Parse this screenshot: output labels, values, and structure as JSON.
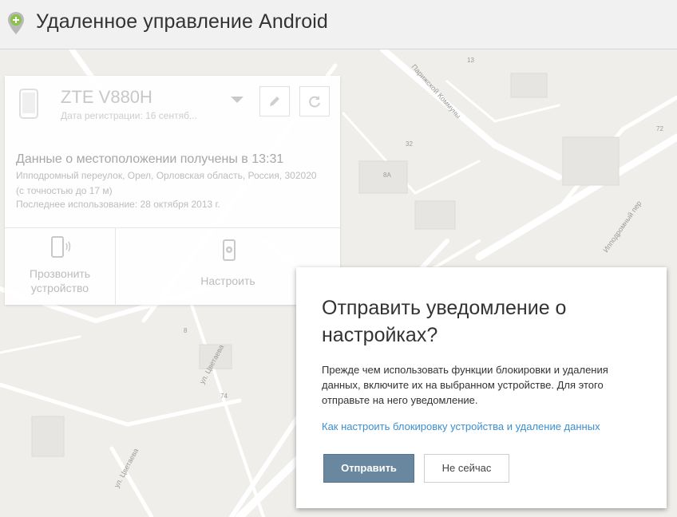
{
  "header": {
    "title": "Удаленное управление Android"
  },
  "device": {
    "name": "ZTE V880H",
    "registered": "Дата регистрации: 16 сентяб...",
    "location_title": "Данные о местоположении получены в 13:31",
    "address": "Ипподромный переулок, Орел, Орловская область, Россия, 302020 (с точностью до 17 м)",
    "last_used": "Последнее использование: 28 октября 2013 г.",
    "ring_label_1": "Прозвонить",
    "ring_label_2": "устройство",
    "setup_label": "Настроить"
  },
  "map": {
    "streets": [
      "Парижской Коммуны",
      "Ипподромный пер",
      "ул. Цветаева",
      "ул. Цветаева"
    ],
    "house_numbers": [
      "13",
      "72",
      "32",
      "8А",
      "8",
      "74"
    ]
  },
  "dialog": {
    "title": "Отправить уведомление о настройках?",
    "body": "Прежде чем использовать функции блокировки и удаления данных, включите их на выбранном устройстве. Для этого отправьте на него уведомление.",
    "link": "Как настроить блокировку устройства и удаление данных",
    "send_button": "Отправить",
    "later_button": "Не сейчас"
  },
  "colors": {
    "accent_link": "#3d8fcf",
    "send_button": "#6a87a0",
    "logo_green": "#8bc34a"
  }
}
